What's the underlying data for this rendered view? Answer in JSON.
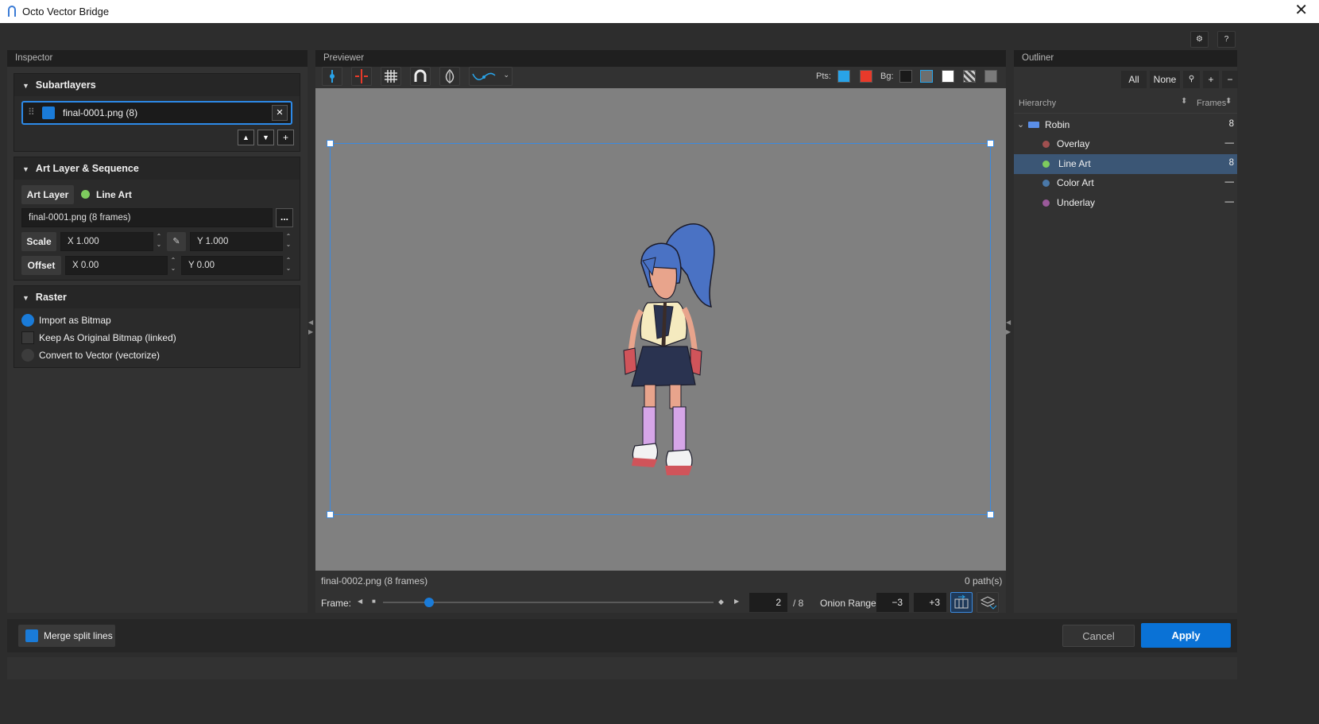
{
  "window": {
    "title": "Octo Vector Bridge",
    "close_glyph": "✕"
  },
  "top_buttons": {
    "settings_glyph": "⚙",
    "help": "?"
  },
  "inspector": {
    "header": "Inspector",
    "subartlayers": {
      "title": "Subartlayers",
      "item": {
        "name": "final-0001.png  (8)",
        "color": "#1a7bd8",
        "remove_glyph": "✕"
      },
      "move_up": "▲",
      "move_down": "▼",
      "add": "+"
    },
    "art_layer": {
      "title": "Art Layer & Sequence",
      "art_layer_button": "Art Layer",
      "layer_name": "Line Art",
      "file_value": "final-0001.png  (8 frames)",
      "browse": "...",
      "scale_label": "Scale",
      "scale_x": "X 1.000",
      "scale_y": "Y 1.000",
      "offset_label": "Offset",
      "offset_x": "X 0.00",
      "offset_y": "Y 0.00"
    },
    "raster": {
      "title": "Raster",
      "options": [
        "Import as Bitmap",
        "Keep As Original Bitmap (linked)",
        "Convert to Vector (vectorize)"
      ],
      "selected": "Import as Bitmap"
    }
  },
  "previewer": {
    "header": "Previewer",
    "pts_label": "Pts:",
    "pts_colors": [
      "#29a3e8",
      "#e83a2a"
    ],
    "bg_label": "Bg:",
    "bg_colors": [
      "#1a1a1a",
      "#6e6e6e",
      "#ffffff",
      "checker",
      "#7a7a7a"
    ],
    "canvas_bg": "#808080",
    "status_file": "final-0002.png  (8 frames)",
    "status_paths": "0 path(s)",
    "frame_label": "Frame:",
    "frame_value": "2",
    "frame_total": "/ 8",
    "frame_fraction": 0.14,
    "onion_label": "Onion Range",
    "onion_minus": "−3",
    "onion_plus": "+3"
  },
  "outliner": {
    "header": "Outliner",
    "buttons": {
      "all": "All",
      "none": "None",
      "search_glyph": "🔍",
      "add": "+",
      "remove": "−"
    },
    "columns": {
      "hierarchy": "Hierarchy",
      "frames": "Frames"
    },
    "root": {
      "name": "Robin",
      "frames": "8",
      "color": "#5b8fe8"
    },
    "layers": [
      {
        "name": "Overlay",
        "frames": "—",
        "color": "#b05a5a",
        "selected": false
      },
      {
        "name": "Line Art",
        "frames": "8",
        "color": "#7ecb5e",
        "selected": true
      },
      {
        "name": "Color Art",
        "frames": "—",
        "color": "#4a78a8",
        "selected": false
      },
      {
        "name": "Underlay",
        "frames": "—",
        "color": "#9a5a9a",
        "selected": false
      }
    ]
  },
  "footer": {
    "merge_label": "Merge split lines",
    "cancel": "Cancel",
    "apply": "Apply",
    "accent": "#0a72d6"
  }
}
